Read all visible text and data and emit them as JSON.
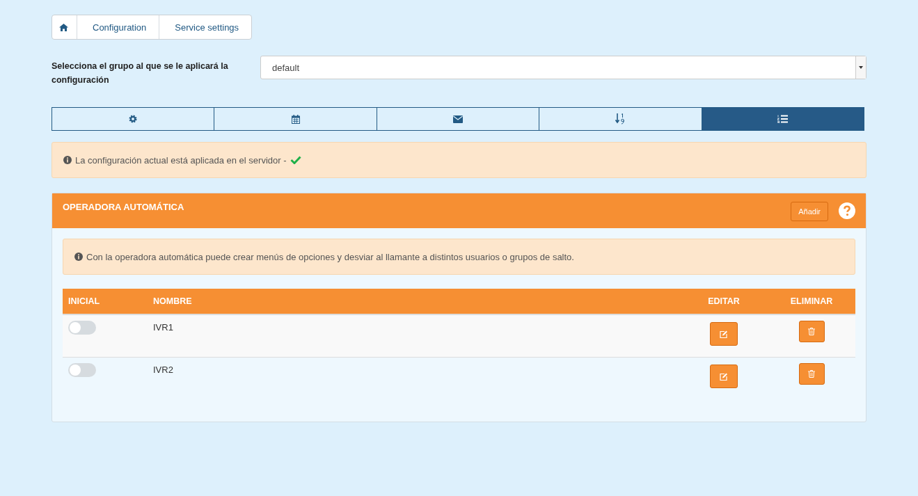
{
  "breadcrumb": [
    {
      "kind": "home"
    },
    {
      "kind": "text",
      "label": "Configuration"
    },
    {
      "kind": "text",
      "label": "Service settings"
    }
  ],
  "group_select": {
    "label": "Selecciona el grupo al que se le aplicará la configuración",
    "value": "default"
  },
  "tabs": [
    {
      "kind": "gear",
      "selected": false
    },
    {
      "kind": "calendar",
      "selected": false
    },
    {
      "kind": "envelope",
      "selected": false
    },
    {
      "kind": "sort",
      "selected": false
    },
    {
      "kind": "list",
      "selected": true
    }
  ],
  "status_alert": {
    "text": "La configuración actual está aplicada en el servidor -",
    "applied": true
  },
  "panel": {
    "title": "OPERADORA AUTOMÁTICA",
    "add_button": "Añadir",
    "info": "Con la operadora automática puede crear menús de opciones y desviar al llamante a distintos usuarios o grupos de salto.",
    "columns": [
      "INICIAL",
      "NOMBRE",
      "EDITAR",
      "ELIMINAR"
    ],
    "rows": [
      {
        "on": false,
        "name": "IVR1"
      },
      {
        "on": false,
        "name": "IVR2"
      }
    ]
  }
}
